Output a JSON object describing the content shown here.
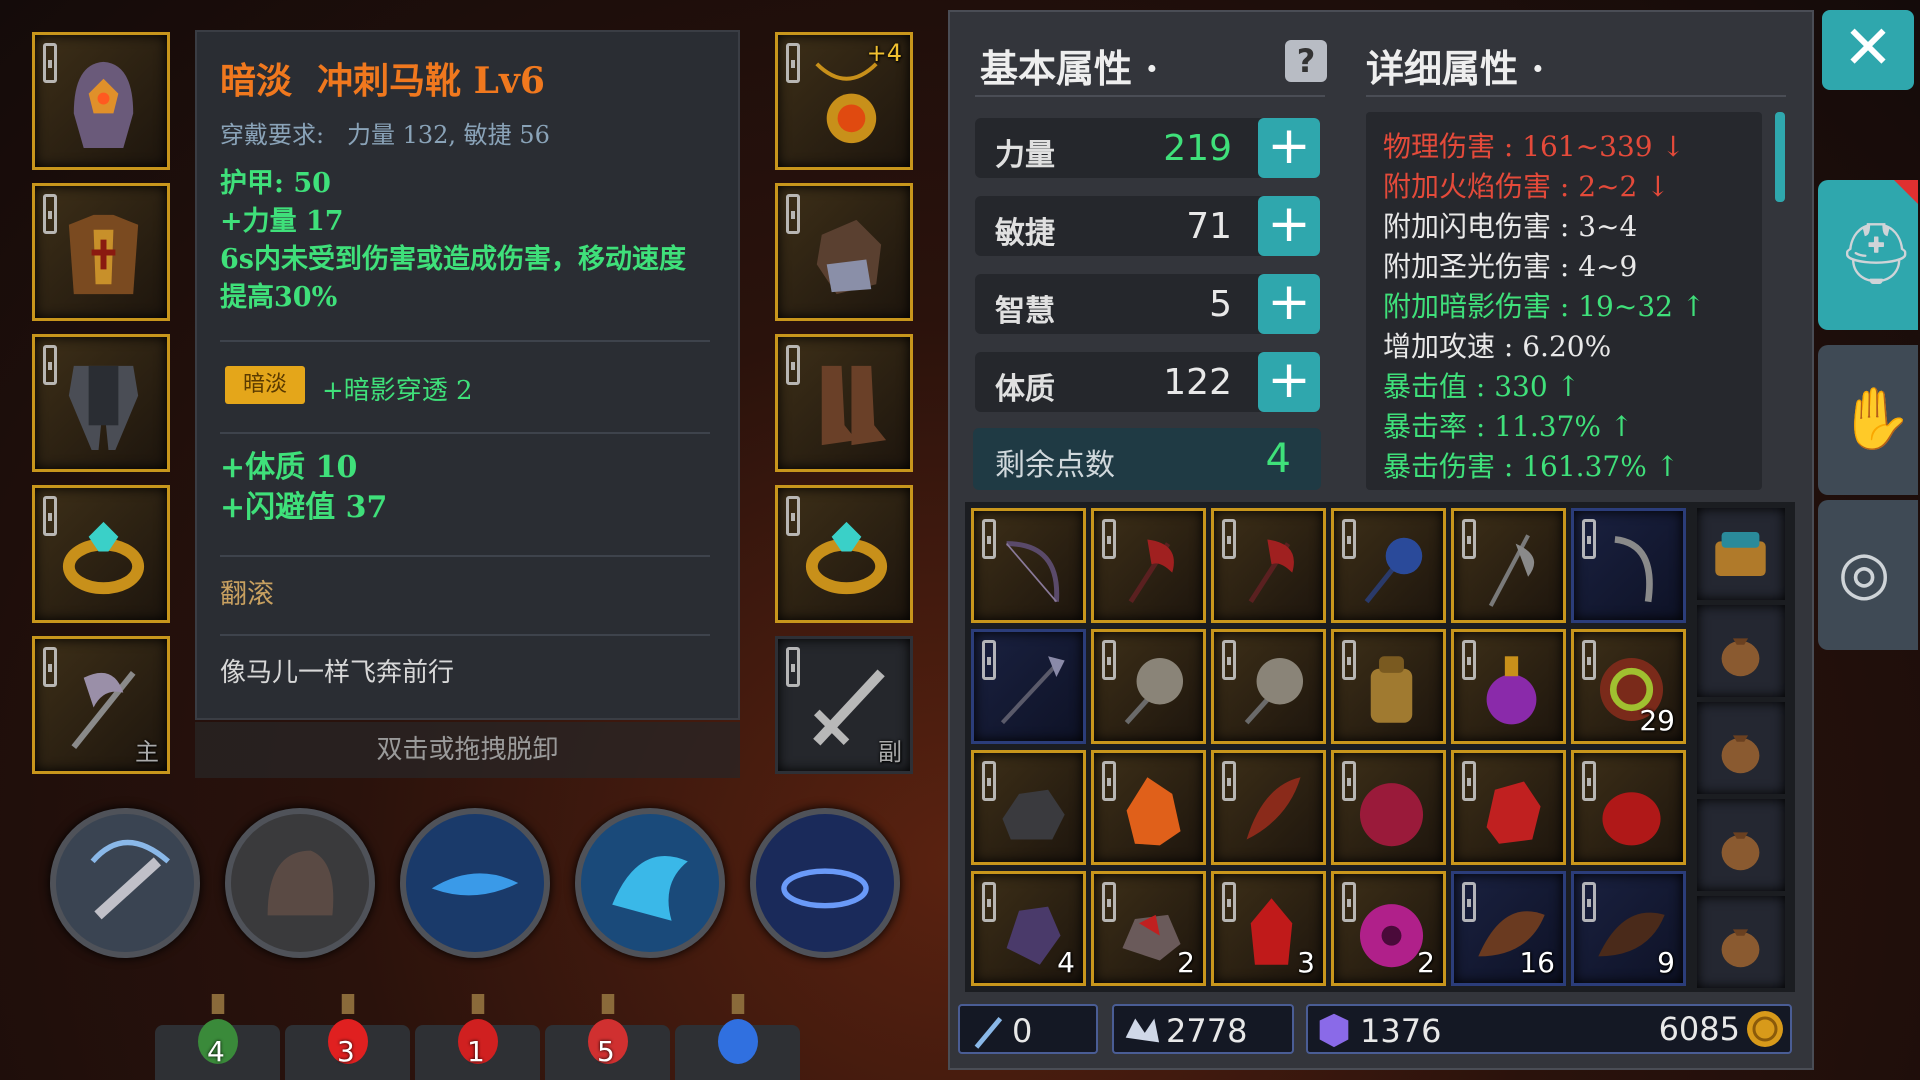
{
  "colors": {
    "gold": "#c8961c",
    "teal": "#2fa7ad",
    "orange": "#f0781e",
    "green": "#3fe07a",
    "red": "#e44a3a"
  },
  "tooltip": {
    "quality": "暗淡",
    "name": "冲刺马靴 Lv6",
    "req_label": "穿戴要求:",
    "req_value": "力量 132, 敏捷 56",
    "armor": "护甲:  50",
    "stat1": "+力量 17",
    "effect": "6s内未受到伤害或造成伤害，移动速度提高30%",
    "tag": "暗淡",
    "tag_bonus": "+暗影穿透 2",
    "bonus1": "+体质 10",
    "bonus2": "+闪避值 37",
    "skill": "翻滚",
    "flavor": "像马儿一样飞奔前行",
    "hint": "双击或拖拽脱卸"
  },
  "equip_left": [
    {
      "icon": "helmet-icon"
    },
    {
      "icon": "chest-armor-icon"
    },
    {
      "icon": "pants-icon"
    },
    {
      "icon": "ring-icon"
    },
    {
      "icon": "axe-icon",
      "badge": "主"
    }
  ],
  "equip_right": [
    {
      "icon": "amulet-icon",
      "badge": "+4"
    },
    {
      "icon": "gloves-icon"
    },
    {
      "icon": "boots-icon"
    },
    {
      "icon": "ring-icon"
    },
    {
      "icon": "sword-icon",
      "badge": "副"
    }
  ],
  "attributes": {
    "tab_basic": "基本属性",
    "tab_detail": "详细属性",
    "stats": [
      {
        "name": "力量",
        "value": "219",
        "color": "#3fe07a"
      },
      {
        "name": "敏捷",
        "value": "71",
        "color": "#e8e8e8"
      },
      {
        "name": "智慧",
        "value": "5",
        "color": "#e8e8e8"
      },
      {
        "name": "体质",
        "value": "122",
        "color": "#e8e8e8"
      }
    ],
    "remaining_label": "剩余点数",
    "remaining_value": "4",
    "plus_glyph": "+",
    "details": [
      {
        "text": "物理伤害 : 161~339 ↓",
        "color": "#e44a3a"
      },
      {
        "text": "附加火焰伤害 : 2~2 ↓",
        "color": "#e44a3a"
      },
      {
        "text": "附加闪电伤害 : 3~4",
        "color": "#e8e8e8"
      },
      {
        "text": "附加圣光伤害 : 4~9",
        "color": "#e8e8e8"
      },
      {
        "text": "附加暗影伤害 : 19~32 ↑",
        "color": "#3fe07a"
      },
      {
        "text": "增加攻速 : 6.20%",
        "color": "#e8e8e8"
      },
      {
        "text": "暴击值 : 330 ↑",
        "color": "#3fe07a"
      },
      {
        "text": "暴击率 : 11.37% ↑",
        "color": "#3fe07a"
      },
      {
        "text": "暴击伤害 : 161.37% ↑",
        "color": "#3fe07a"
      }
    ]
  },
  "inventory": [
    {
      "icon": "bow-icon",
      "count": ""
    },
    {
      "icon": "red-axe-icon",
      "count": ""
    },
    {
      "icon": "red-axe-icon",
      "count": ""
    },
    {
      "icon": "blue-mace-icon",
      "count": ""
    },
    {
      "icon": "halberd-icon",
      "count": ""
    },
    {
      "icon": "scythe-icon",
      "count": ""
    },
    {
      "icon": "spear-icon",
      "count": ""
    },
    {
      "icon": "battle-axe-icon",
      "count": ""
    },
    {
      "icon": "battle-axe-icon",
      "count": ""
    },
    {
      "icon": "backpack-icon",
      "count": ""
    },
    {
      "icon": "purple-potion-icon",
      "count": ""
    },
    {
      "icon": "swirl-orb-icon",
      "count": "29"
    },
    {
      "icon": "coal-ore-icon",
      "count": ""
    },
    {
      "icon": "fire-crystal-icon",
      "count": ""
    },
    {
      "icon": "red-feather-icon",
      "count": ""
    },
    {
      "icon": "crimson-blob-icon",
      "count": ""
    },
    {
      "icon": "ruby-ore-icon",
      "count": ""
    },
    {
      "icon": "red-gem-icon",
      "count": ""
    },
    {
      "icon": "amethyst-icon",
      "count": "4"
    },
    {
      "icon": "red-ore-icon",
      "count": "2"
    },
    {
      "icon": "red-crystal-icon",
      "count": "3"
    },
    {
      "icon": "magenta-flower-icon",
      "count": "2"
    },
    {
      "icon": "brown-fur-icon",
      "count": "16"
    },
    {
      "icon": "dark-fur-icon",
      "count": "9"
    }
  ],
  "bags": [
    {
      "icon": "chest-bag-icon"
    },
    {
      "icon": "pouch-icon"
    },
    {
      "icon": "pouch-icon"
    },
    {
      "icon": "pouch-icon"
    },
    {
      "icon": "pouch-icon"
    }
  ],
  "currencies": [
    {
      "icon": "trident-icon",
      "value": "0"
    },
    {
      "icon": "crown-icon",
      "value": "2778"
    },
    {
      "icon": "gem-icon",
      "value": "1376"
    },
    {
      "icon": "gold-coin-icon",
      "value": "6085"
    }
  ],
  "skills": [
    {
      "icon": "sword-slash-icon"
    },
    {
      "icon": "rock-armor-icon"
    },
    {
      "icon": "dash-icon"
    },
    {
      "icon": "wave-icon"
    },
    {
      "icon": "whirl-icon"
    }
  ],
  "potions": [
    {
      "icon": "green-potion-icon",
      "count": "4"
    },
    {
      "icon": "red-potion-icon",
      "count": "3"
    },
    {
      "icon": "red-vial-icon",
      "count": "1"
    },
    {
      "icon": "red-flask-icon",
      "count": "5"
    },
    {
      "icon": "blue-vial-icon",
      "count": ""
    }
  ],
  "side_tabs": [
    {
      "icon": "helmet-tab-icon"
    },
    {
      "icon": "gloves-tab-icon"
    },
    {
      "icon": "target-tab-icon"
    }
  ]
}
